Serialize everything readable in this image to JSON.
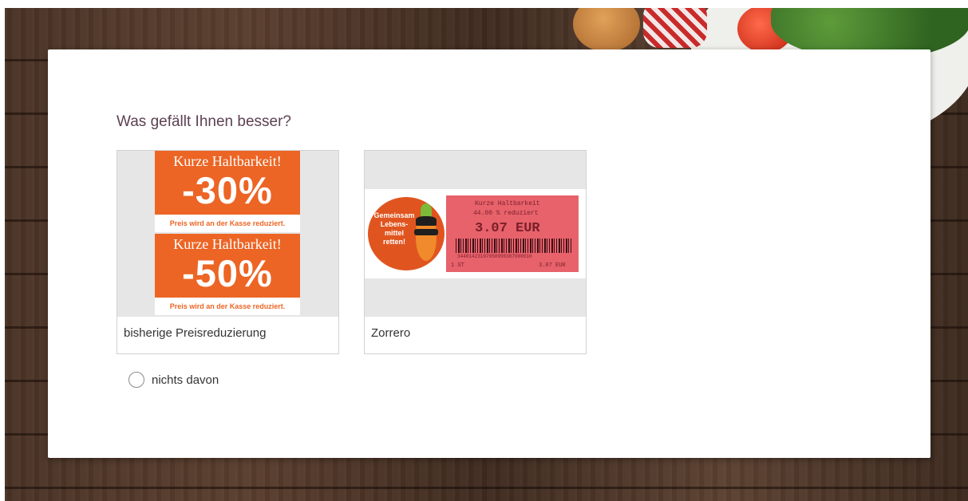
{
  "survey": {
    "question": "Was gefällt Ihnen besser?",
    "options": [
      {
        "label": "bisherige Preisreduzierung"
      },
      {
        "label": "Zorrero"
      }
    ],
    "none_option": {
      "label": "nichts davon",
      "selected": false
    }
  },
  "image_a": {
    "tags": [
      {
        "title": "Kurze Haltbarkeit!",
        "percent": "-30%",
        "footer": "Preis wird an der Kasse reduziert."
      },
      {
        "title": "Kurze Haltbarkeit!",
        "percent": "-50%",
        "footer": "Preis wird an der Kasse reduziert."
      }
    ]
  },
  "image_b": {
    "sticker_text": "Gemeinsam Lebens- mittel retten!",
    "receipt": {
      "line1": "Kurze Haltbarkeit",
      "line2": "44.00 % reduziert",
      "price": "3.07 EUR",
      "code": "34401423107050990307000010",
      "left": "1 ST",
      "right": "3.07 EUR"
    }
  },
  "colors": {
    "accent_orange": "#ec6525",
    "question_text": "#5d4152",
    "receipt_red": "#e7626b"
  }
}
